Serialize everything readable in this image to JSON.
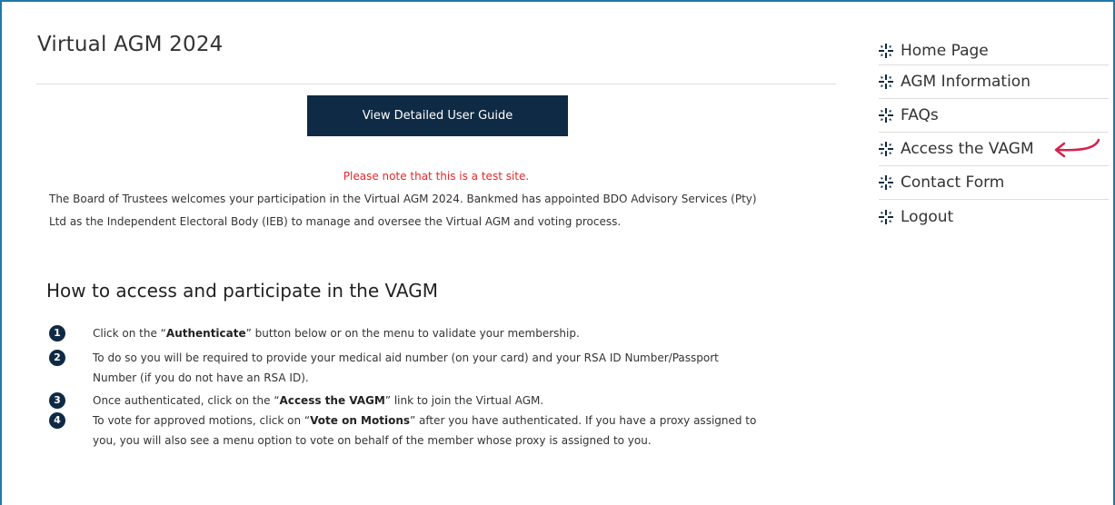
{
  "page": {
    "title": "Virtual AGM 2024",
    "guide_button": "View Detailed User Guide",
    "test_note": "Please note that this is a test site.",
    "intro_line1": "The Board of Trustees welcomes your participation in the Virtual AGM 2024. Bankmed has appointed BDO Advisory Services (Pty)",
    "intro_line2": "Ltd as the Independent Electoral Body (IEB) to manage and oversee the Virtual AGM and voting process.",
    "how_heading": "How to access and participate in the VAGM"
  },
  "steps": [
    {
      "number": "1",
      "before": "Click on the “",
      "bold": "Authenticate",
      "after": "” button below or on the menu to validate your membership."
    },
    {
      "number": "2",
      "line1": "To do so you will be required to provide your medical aid number (on your card) and your RSA ID Number/Passport",
      "line2": "Number (if you do not have an RSA ID)."
    },
    {
      "number": "3",
      "before": "Once authenticated, click on the “",
      "bold": "Access the VAGM",
      "after": "” link to join the Virtual AGM."
    },
    {
      "number": "4",
      "before": "To vote for approved motions, click on “",
      "bold": "Vote on Motions",
      "after": "” after you have authenticated. If you have a proxy assigned to",
      "line2": "you, you will also see a menu option to vote on behalf of the member whose proxy is assigned to you."
    }
  ],
  "menu": {
    "items": [
      {
        "label": "Home Page",
        "icon": "compass-cross-icon"
      },
      {
        "label": "AGM Information",
        "icon": "compass-cross-icon"
      },
      {
        "label": "FAQs",
        "icon": "compass-cross-icon"
      },
      {
        "label": "Access the VAGM",
        "icon": "compass-cross-icon"
      },
      {
        "label": "Contact Form",
        "icon": "compass-cross-icon"
      },
      {
        "label": "Logout",
        "icon": "compass-cross-icon"
      }
    ]
  },
  "colors": {
    "frame_border": "#1f79a8",
    "navy": "#0f2a44",
    "note_red": "#e8262b",
    "arrow_red": "#d6214a"
  }
}
